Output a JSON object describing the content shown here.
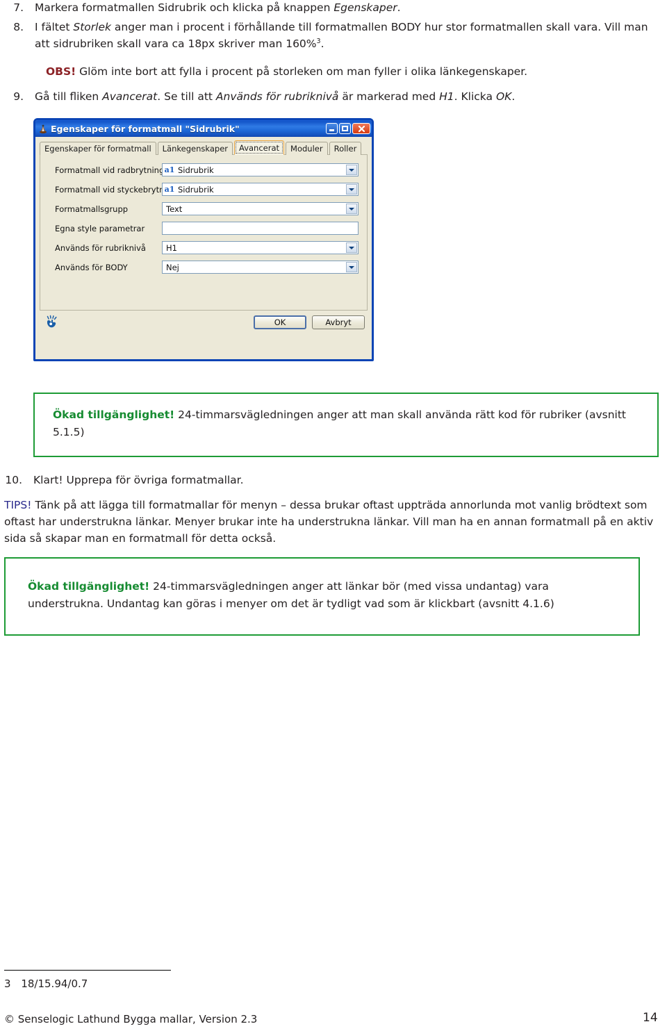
{
  "document": {
    "steps": [
      {
        "number": "7.",
        "parts": [
          {
            "t": "Markera formatmallen Sidrubrik och klicka på knappen ",
            "style": "normal"
          },
          {
            "t": "Egenskaper",
            "style": "italic"
          },
          {
            "t": ".",
            "style": "normal"
          }
        ],
        "plain": "Markera formatmallen Sidrubrik och klicka på knappen Egenskaper."
      },
      {
        "number": "8.",
        "plain": "I fältet Storlek anger man i procent i förhållande till formatmallen BODY hur stor formatmallen skall vara. Vill man att sidrubriken skall vara ca 18px skriver man 160%3."
      },
      {
        "number": "9.",
        "plain": "Gå till fliken Avancerat. Se till att Används för rubriknivå är markerad med H1. Klicka OK."
      },
      {
        "number": "10.",
        "plain": "Klart! Upprepa för övriga formatmallar."
      }
    ],
    "step8": {
      "pre": "I fältet ",
      "em1": "Storlek",
      "mid": " anger man i procent i förhållande till formatmallen BODY hur stor formatmallen skall vara. Vill man att sidrubriken skall vara ca 18px skriver man 160%",
      "footnote_marker": "3",
      "post": "."
    },
    "step9": {
      "pre": "Gå till fliken ",
      "em1": "Avancerat",
      "mid1": ". Se till att ",
      "em2": "Används för rubriknivå",
      "mid2": " är markerad med ",
      "em3": "H1",
      "post": ". Klicka ",
      "em4": "OK",
      "end": "."
    },
    "step10": {
      "text": "Klart! Upprepa för övriga formatmallar."
    },
    "obs": {
      "label": "OBS!",
      "text": " Glöm inte bort att fylla i procent på storleken om man fyller i olika länkegenskaper."
    },
    "tips": {
      "label": "TIPS!",
      "text": " Tänk på att lägga till formatmallar för menyn – dessa brukar oftast uppträda annorlunda mot vanlig brödtext som oftast har understrukna länkar. Menyer brukar inte ha understrukna länkar. Vill man ha en annan formatmall på en aktiv sida så skapar man en formatmall för detta också."
    },
    "callouts": [
      {
        "label": "Ökad tillgänglighet!",
        "text": " 24-timmarsvägledningen anger att man skall använda rätt kod för rubriker (avsnitt 5.1.5)"
      },
      {
        "label": "Ökad tillgänglighet!",
        "text": " 24-timmarsvägledningen anger att länkar bör (med vissa undantag) vara understrukna.  Undantag kan göras i menyer om det är tydligt vad som är klickbart (avsnitt 4.1.6)"
      }
    ],
    "footnote": {
      "marker": "3",
      "text": "18/15.94/0.7"
    },
    "footer": {
      "left": "© Senselogic Lathund Bygga mallar, Version 2.3",
      "page": "14"
    },
    "colors": {
      "obs": "#8c2226",
      "tips": "#2a2a8c",
      "green": "#178c32",
      "green_border": "#1d9b35",
      "body_text": "#231f20"
    }
  },
  "dialog": {
    "title": "Egenskaper för formatmall \"Sidrubrik\"",
    "title_icon": "app-icon",
    "window_buttons": {
      "minimize": "minimize-button",
      "maximize": "maximize-button",
      "close": "close-button"
    },
    "tabs": [
      {
        "label": "Egenskaper för formatmall",
        "active": false
      },
      {
        "label": "Länkegenskaper",
        "active": false
      },
      {
        "label": "Avancerat",
        "active": true
      },
      {
        "label": "Moduler",
        "active": false
      },
      {
        "label": "Roller",
        "active": false
      }
    ],
    "fields": [
      {
        "label": "Formatmall vid radbrytning",
        "value": "Sidrubrik",
        "icon": "a1",
        "type": "dropdown"
      },
      {
        "label": "Formatmall vid styckebrytning",
        "value": "Sidrubrik",
        "icon": "a1",
        "type": "dropdown"
      },
      {
        "label": "Formatmallsgrupp",
        "value": "Text",
        "icon": "",
        "type": "dropdown"
      },
      {
        "label": "Egna style parametrar",
        "value": "",
        "icon": "",
        "type": "text"
      },
      {
        "label": "Används för rubriknivå",
        "value": "H1",
        "icon": "",
        "type": "dropdown"
      },
      {
        "label": "Används för BODY",
        "value": "Nej",
        "icon": "",
        "type": "dropdown"
      }
    ],
    "footer_icon": "accessibility-hand-icon",
    "buttons": {
      "ok": "OK",
      "cancel": "Avbryt"
    },
    "colors": {
      "titlebar": "#1c62d0",
      "face": "#ece9d8",
      "border": "#0a44b5",
      "active_tab_border": "#e8a33d"
    }
  }
}
